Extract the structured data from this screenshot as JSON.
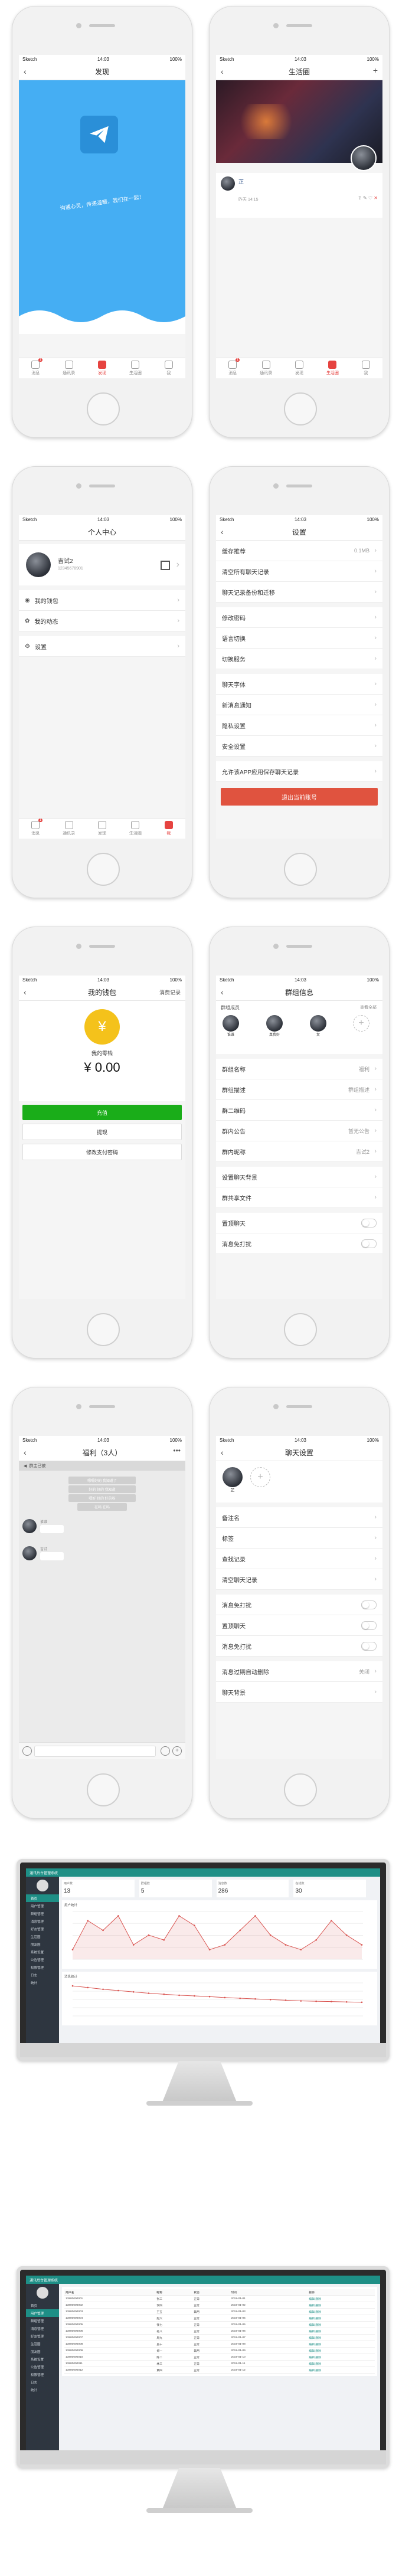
{
  "status": {
    "carrier": "Sketch",
    "time": "14:03",
    "battery": "100%"
  },
  "tabs": [
    "消息",
    "通讯录",
    "发现",
    "生活圈",
    "我"
  ],
  "screen1": {
    "title": "发现",
    "slogan": "沟通心灵，传递温暖，我们在一起！"
  },
  "screen2": {
    "title": "生活圈",
    "user": "芷",
    "time": "昨天 14:15"
  },
  "screen3": {
    "title": "个人中心",
    "name": "吉试2",
    "id": "12345678901",
    "items": [
      "我的钱包",
      "我的动态",
      "设置"
    ]
  },
  "screen4": {
    "title": "设置",
    "items": [
      {
        "label": "缓存推荐",
        "value": "0.1MB"
      },
      {
        "label": "清空所有聊天记录",
        "value": ""
      },
      {
        "label": "聊天记录备份和迁移",
        "value": ""
      },
      {
        "label": "修改密码",
        "value": ""
      },
      {
        "label": "语言切换",
        "value": ""
      },
      {
        "label": "切换服务",
        "value": ""
      },
      {
        "label": "聊天字体",
        "value": ""
      },
      {
        "label": "新消息通知",
        "value": ""
      },
      {
        "label": "隐私设置",
        "value": ""
      },
      {
        "label": "安全设置",
        "value": ""
      },
      {
        "label": "允许该APP应用保存聊天记录",
        "value": ""
      }
    ],
    "logout": "退出当前账号"
  },
  "screen5": {
    "title": "我的钱包",
    "right": "消费记录",
    "label": "我的零钱",
    "amount": "¥ 0.00",
    "recharge": "充值",
    "withdraw": "提现",
    "paypwd": "修改支付密码"
  },
  "screen6": {
    "title": "群组信息",
    "members_label": "群组成员",
    "more": "查看全部",
    "members": [
      "谁谁",
      "真我好",
      "女"
    ],
    "rows": [
      {
        "label": "群组名称",
        "value": "福利"
      },
      {
        "label": "群组描述",
        "value": "群组描述"
      },
      {
        "label": "群二维码",
        "value": ""
      },
      {
        "label": "群内公告",
        "value": "暂无公告"
      },
      {
        "label": "群内昵称",
        "value": "吉试2"
      },
      {
        "label": "设置聊天背景",
        "value": ""
      },
      {
        "label": "群共享文件",
        "value": ""
      },
      {
        "label": "置顶聊天",
        "value": ""
      },
      {
        "label": "消息免打扰",
        "value": ""
      }
    ]
  },
  "screen7": {
    "title": "福利（3人）",
    "notice": "群主已被",
    "bubbles": [
      "嗯嗯好的 我知道了",
      "好的 好的 我知道",
      "嗯好 好的 好的呀",
      "在吗 在吗"
    ],
    "names": [
      "谁谁",
      "吉试"
    ]
  },
  "screen8": {
    "title": "聊天设置",
    "user": "芷",
    "rows": [
      "备注名",
      "标签",
      "查找记录",
      "清空聊天记录",
      "消息免打扰",
      "置顶聊天",
      "消息免打扰",
      "消息过期自动删除",
      "聊天背景"
    ],
    "burn": "关闭"
  },
  "admin1": {
    "title": "通讯后台管理系统",
    "stats": [
      {
        "label": "用户数",
        "value": "13"
      },
      {
        "label": "群组数",
        "value": "5"
      },
      {
        "label": "消息数",
        "value": "286"
      },
      {
        "label": "在线数",
        "value": "30"
      }
    ],
    "menu": [
      "首页",
      "用户管理",
      "群组管理",
      "消息管理",
      "好友管理",
      "生活圈",
      "朋友圈",
      "系统设置",
      "公告管理",
      "权限管理",
      "日志",
      "统计"
    ],
    "chart1_title": "用户统计",
    "chart2_title": "消息统计"
  },
  "admin2": {
    "title": "通讯后台管理系统",
    "menu": [
      "首页",
      "用户管理",
      "群组管理",
      "消息管理",
      "好友管理",
      "生活圈",
      "朋友圈",
      "系统设置",
      "公告管理",
      "权限管理",
      "日志",
      "统计"
    ],
    "headers": [
      "用户名",
      "昵称",
      "状态",
      "时间",
      "操作"
    ],
    "rows": [
      [
        "13800000001",
        "张三",
        "正常",
        "2019-01-01",
        "编辑 删除"
      ],
      [
        "13800000002",
        "李四",
        "正常",
        "2019-01-02",
        "编辑 删除"
      ],
      [
        "13800000003",
        "王五",
        "禁用",
        "2019-01-03",
        "编辑 删除"
      ],
      [
        "13800000004",
        "赵六",
        "正常",
        "2019-01-04",
        "编辑 删除"
      ],
      [
        "13800000005",
        "钱七",
        "正常",
        "2019-01-05",
        "编辑 删除"
      ],
      [
        "13800000006",
        "孙八",
        "正常",
        "2019-01-06",
        "编辑 删除"
      ],
      [
        "13800000007",
        "周九",
        "正常",
        "2019-01-07",
        "编辑 删除"
      ],
      [
        "13800000008",
        "吴十",
        "正常",
        "2019-01-08",
        "编辑 删除"
      ],
      [
        "13800000009",
        "郑一",
        "禁用",
        "2019-01-09",
        "编辑 删除"
      ],
      [
        "13800000010",
        "陈二",
        "正常",
        "2019-01-10",
        "编辑 删除"
      ],
      [
        "13800000011",
        "林三",
        "正常",
        "2019-01-11",
        "编辑 删除"
      ],
      [
        "13800000012",
        "黄四",
        "正常",
        "2019-01-12",
        "编辑 删除"
      ]
    ]
  },
  "chart_data": [
    {
      "type": "line",
      "title": "用户统计",
      "x": [
        1,
        2,
        3,
        4,
        5,
        6,
        7,
        8,
        9,
        10,
        11,
        12,
        13,
        14,
        15,
        16,
        17,
        18,
        19,
        20
      ],
      "series": [
        {
          "values": [
            2,
            8,
            6,
            9,
            3,
            5,
            4,
            9,
            7,
            2,
            3,
            6,
            9,
            5,
            3,
            2,
            4,
            8,
            5,
            3
          ]
        }
      ]
    },
    {
      "type": "line",
      "title": "消息统计",
      "x": [
        1,
        2,
        3,
        4,
        5,
        6,
        7,
        8,
        9,
        10,
        11,
        12,
        13,
        14,
        15,
        16,
        17,
        18,
        19,
        20
      ],
      "series": [
        {
          "values": [
            9,
            8.5,
            8,
            7.6,
            7.2,
            6.8,
            6.5,
            6.2,
            6,
            5.8,
            5.5,
            5.3,
            5.1,
            4.9,
            4.7,
            4.5,
            4.4,
            4.3,
            4.2,
            4.1
          ]
        }
      ]
    }
  ]
}
